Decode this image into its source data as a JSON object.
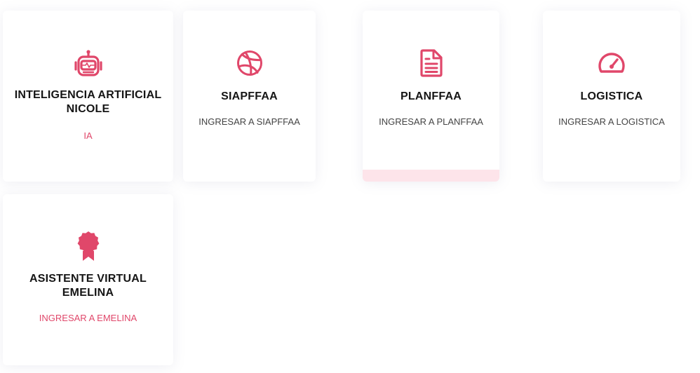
{
  "cards": [
    {
      "title": "INTELIGENCIA ARTIFICIAL NICOLE",
      "link": "IA",
      "icon": "robot-icon"
    },
    {
      "title": "SIAPFFAA",
      "link": "INGRESAR A SIAPFFAA",
      "icon": "basketball-icon"
    },
    {
      "title": "PLANFFAA",
      "link": "INGRESAR A PLANFFAA",
      "icon": "document-icon"
    },
    {
      "title": "LOGISTICA",
      "link": "INGRESAR A LOGISTICA",
      "icon": "speedometer-icon"
    },
    {
      "title": "ASISTENTE VIRTUAL EMELINA",
      "link": "INGRESAR A EMELINA",
      "icon": "award-badge-icon"
    }
  ],
  "colors": {
    "accent": "#e0476a",
    "title": "#151515",
    "link": "#444444",
    "hover_bar": "#fde4ea"
  }
}
